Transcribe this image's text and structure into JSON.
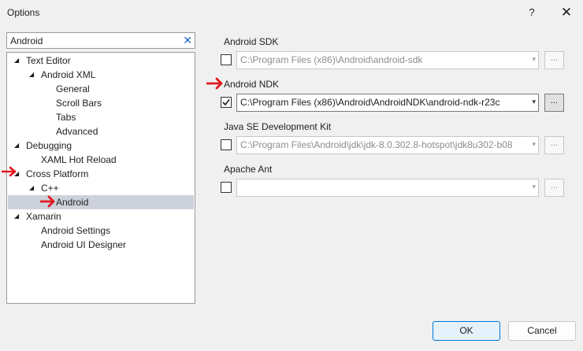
{
  "window": {
    "title": "Options",
    "help_glyph": "?",
    "close_glyph": "✕"
  },
  "search": {
    "value": "Android",
    "clear_glyph": "✕"
  },
  "tree": {
    "items": [
      {
        "label": "Text Editor",
        "expander": "◢"
      },
      {
        "label": "Android XML",
        "expander": "◢"
      },
      {
        "label": "General"
      },
      {
        "label": "Scroll Bars"
      },
      {
        "label": "Tabs"
      },
      {
        "label": "Advanced"
      },
      {
        "label": "Debugging",
        "expander": "◢"
      },
      {
        "label": "XAML Hot Reload"
      },
      {
        "label": "Cross Platform",
        "expander": "◢"
      },
      {
        "label": "C++",
        "expander": "◢"
      },
      {
        "label": "Android",
        "selected": true
      },
      {
        "label": "Xamarin",
        "expander": "◢"
      },
      {
        "label": "Android Settings"
      },
      {
        "label": "Android UI Designer"
      }
    ]
  },
  "settings": {
    "android_sdk": {
      "label": "Android SDK",
      "checked": false,
      "path": "C:\\Program Files (x86)\\Android\\android-sdk",
      "browse": "..."
    },
    "android_ndk": {
      "label": "Android NDK",
      "checked": true,
      "path": "C:\\Program Files (x86)\\Android\\AndroidNDK\\android-ndk-r23c",
      "browse": "..."
    },
    "java_jdk": {
      "label": "Java SE Development Kit",
      "checked": false,
      "path": "C:\\Program Files\\Android\\jdk\\jdk-8.0.302.8-hotspot\\jdk8u302-b08",
      "browse": "..."
    },
    "apache_ant": {
      "label": "Apache Ant",
      "checked": false,
      "path": "",
      "browse": "..."
    },
    "combo_arrow": "▾"
  },
  "buttons": {
    "ok": "OK",
    "cancel": "Cancel"
  },
  "colors": {
    "annotation_arrow": "#e0191f",
    "selected_row": "#cdd1da",
    "ok_border": "#0078d4"
  }
}
